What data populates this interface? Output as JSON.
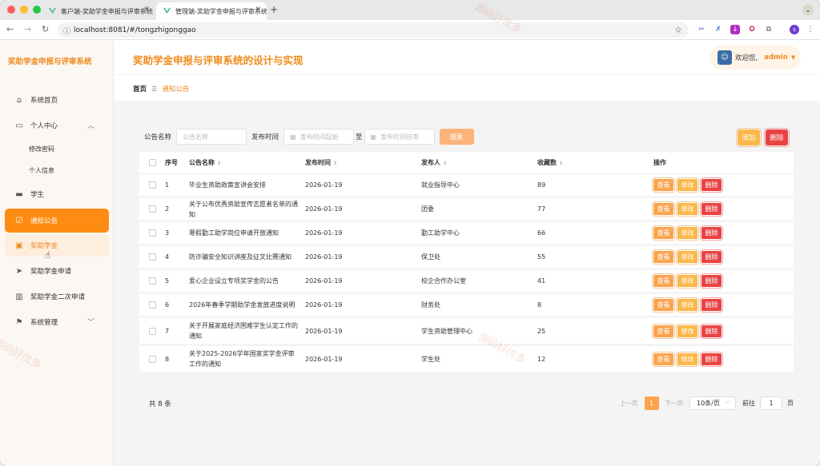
{
  "browser": {
    "tabs": [
      {
        "title": "客户端-奖助学金申报与评审系统",
        "active": false
      },
      {
        "title": "管理端-奖助学金申报与评审系统",
        "active": true
      }
    ],
    "url": "localhost:8081/#/tongzhigonggao",
    "new_tab": "+",
    "profile_initial": "s"
  },
  "app": {
    "logo": "奖助学金申报与评审系统",
    "page_title": "奖助学金申报与评审系统的设计与实现",
    "user": {
      "greeting": "欢迎您,",
      "name": "admin"
    }
  },
  "sidebar": {
    "items": [
      {
        "label": "系统首页",
        "icon": "home-icon"
      },
      {
        "label": "个人中心",
        "icon": "profile-icon",
        "expanded": true
      },
      {
        "label": "修改密码"
      },
      {
        "label": "个人信息"
      },
      {
        "label": "学生",
        "icon": "chat-icon"
      },
      {
        "label": "通知公告",
        "icon": "notice-icon",
        "active": true
      },
      {
        "label": "奖助学金",
        "icon": "briefcase-icon",
        "hover": true
      },
      {
        "label": "奖助学金申请",
        "icon": "send-icon"
      },
      {
        "label": "奖助学金二次申请",
        "icon": "bar-chart-icon"
      },
      {
        "label": "系统管理",
        "icon": "flag-icon",
        "expanded": false
      }
    ]
  },
  "breadcrumb": {
    "home": "首页",
    "current": "通知公告"
  },
  "search": {
    "name_label": "公告名称",
    "name_placeholder": "公告名称",
    "time_label": "发布时间",
    "start_placeholder": "发布时间起始",
    "to_label": "至",
    "end_placeholder": "发布时间结束",
    "search_button": "搜索"
  },
  "toolbar": {
    "add_label": "添加",
    "delete_label": "删除"
  },
  "table": {
    "headers": [
      "序号",
      "公告名称",
      "发布时间",
      "发布人",
      "收藏数",
      "操作"
    ],
    "actions": {
      "view": "查看",
      "edit": "修改",
      "delete": "删除"
    },
    "rows": [
      {
        "no": "1",
        "title": "毕业生资助政策宣讲会安排",
        "date": "2026-01-19",
        "publisher": "就业指导中心",
        "favorites": "89"
      },
      {
        "no": "2",
        "title": "关于公布优秀资助宣传志愿者名单的通知",
        "date": "2026-01-19",
        "publisher": "团委",
        "favorites": "77"
      },
      {
        "no": "3",
        "title": "寒假勤工助学岗位申请开放通知",
        "date": "2026-01-19",
        "publisher": "勤工助学中心",
        "favorites": "66"
      },
      {
        "no": "4",
        "title": "防诈骗安全知识讲座及征文比赛通知",
        "date": "2026-01-19",
        "publisher": "保卫处",
        "favorites": "55"
      },
      {
        "no": "5",
        "title": "爱心企业设立专项奖学金的公告",
        "date": "2026-01-19",
        "publisher": "校企合作办公室",
        "favorites": "41"
      },
      {
        "no": "6",
        "title": "2026年春季学期助学金发放进度说明",
        "date": "2026-01-19",
        "publisher": "财务处",
        "favorites": "8"
      },
      {
        "no": "7",
        "title": "关于开展家庭经济困难学生认定工作的通知",
        "date": "2026-01-19",
        "publisher": "学生资助管理中心",
        "favorites": "25"
      },
      {
        "no": "8",
        "title": "关于2025-2026学年国家奖学金评审工作的通知",
        "date": "2026-01-19",
        "publisher": "学生处",
        "favorites": "12"
      }
    ]
  },
  "pagination": {
    "total": "共 8 条",
    "prev": "上一页",
    "current_page": "1",
    "next": "下一页",
    "page_size": "10条/页",
    "goto_label": "前往",
    "goto_value": "1",
    "page_unit": "页"
  },
  "watermark": "源码好优多",
  "colors": {
    "accent": "#ff8c12",
    "title": "#f08a1c",
    "danger": "#ea4343"
  }
}
